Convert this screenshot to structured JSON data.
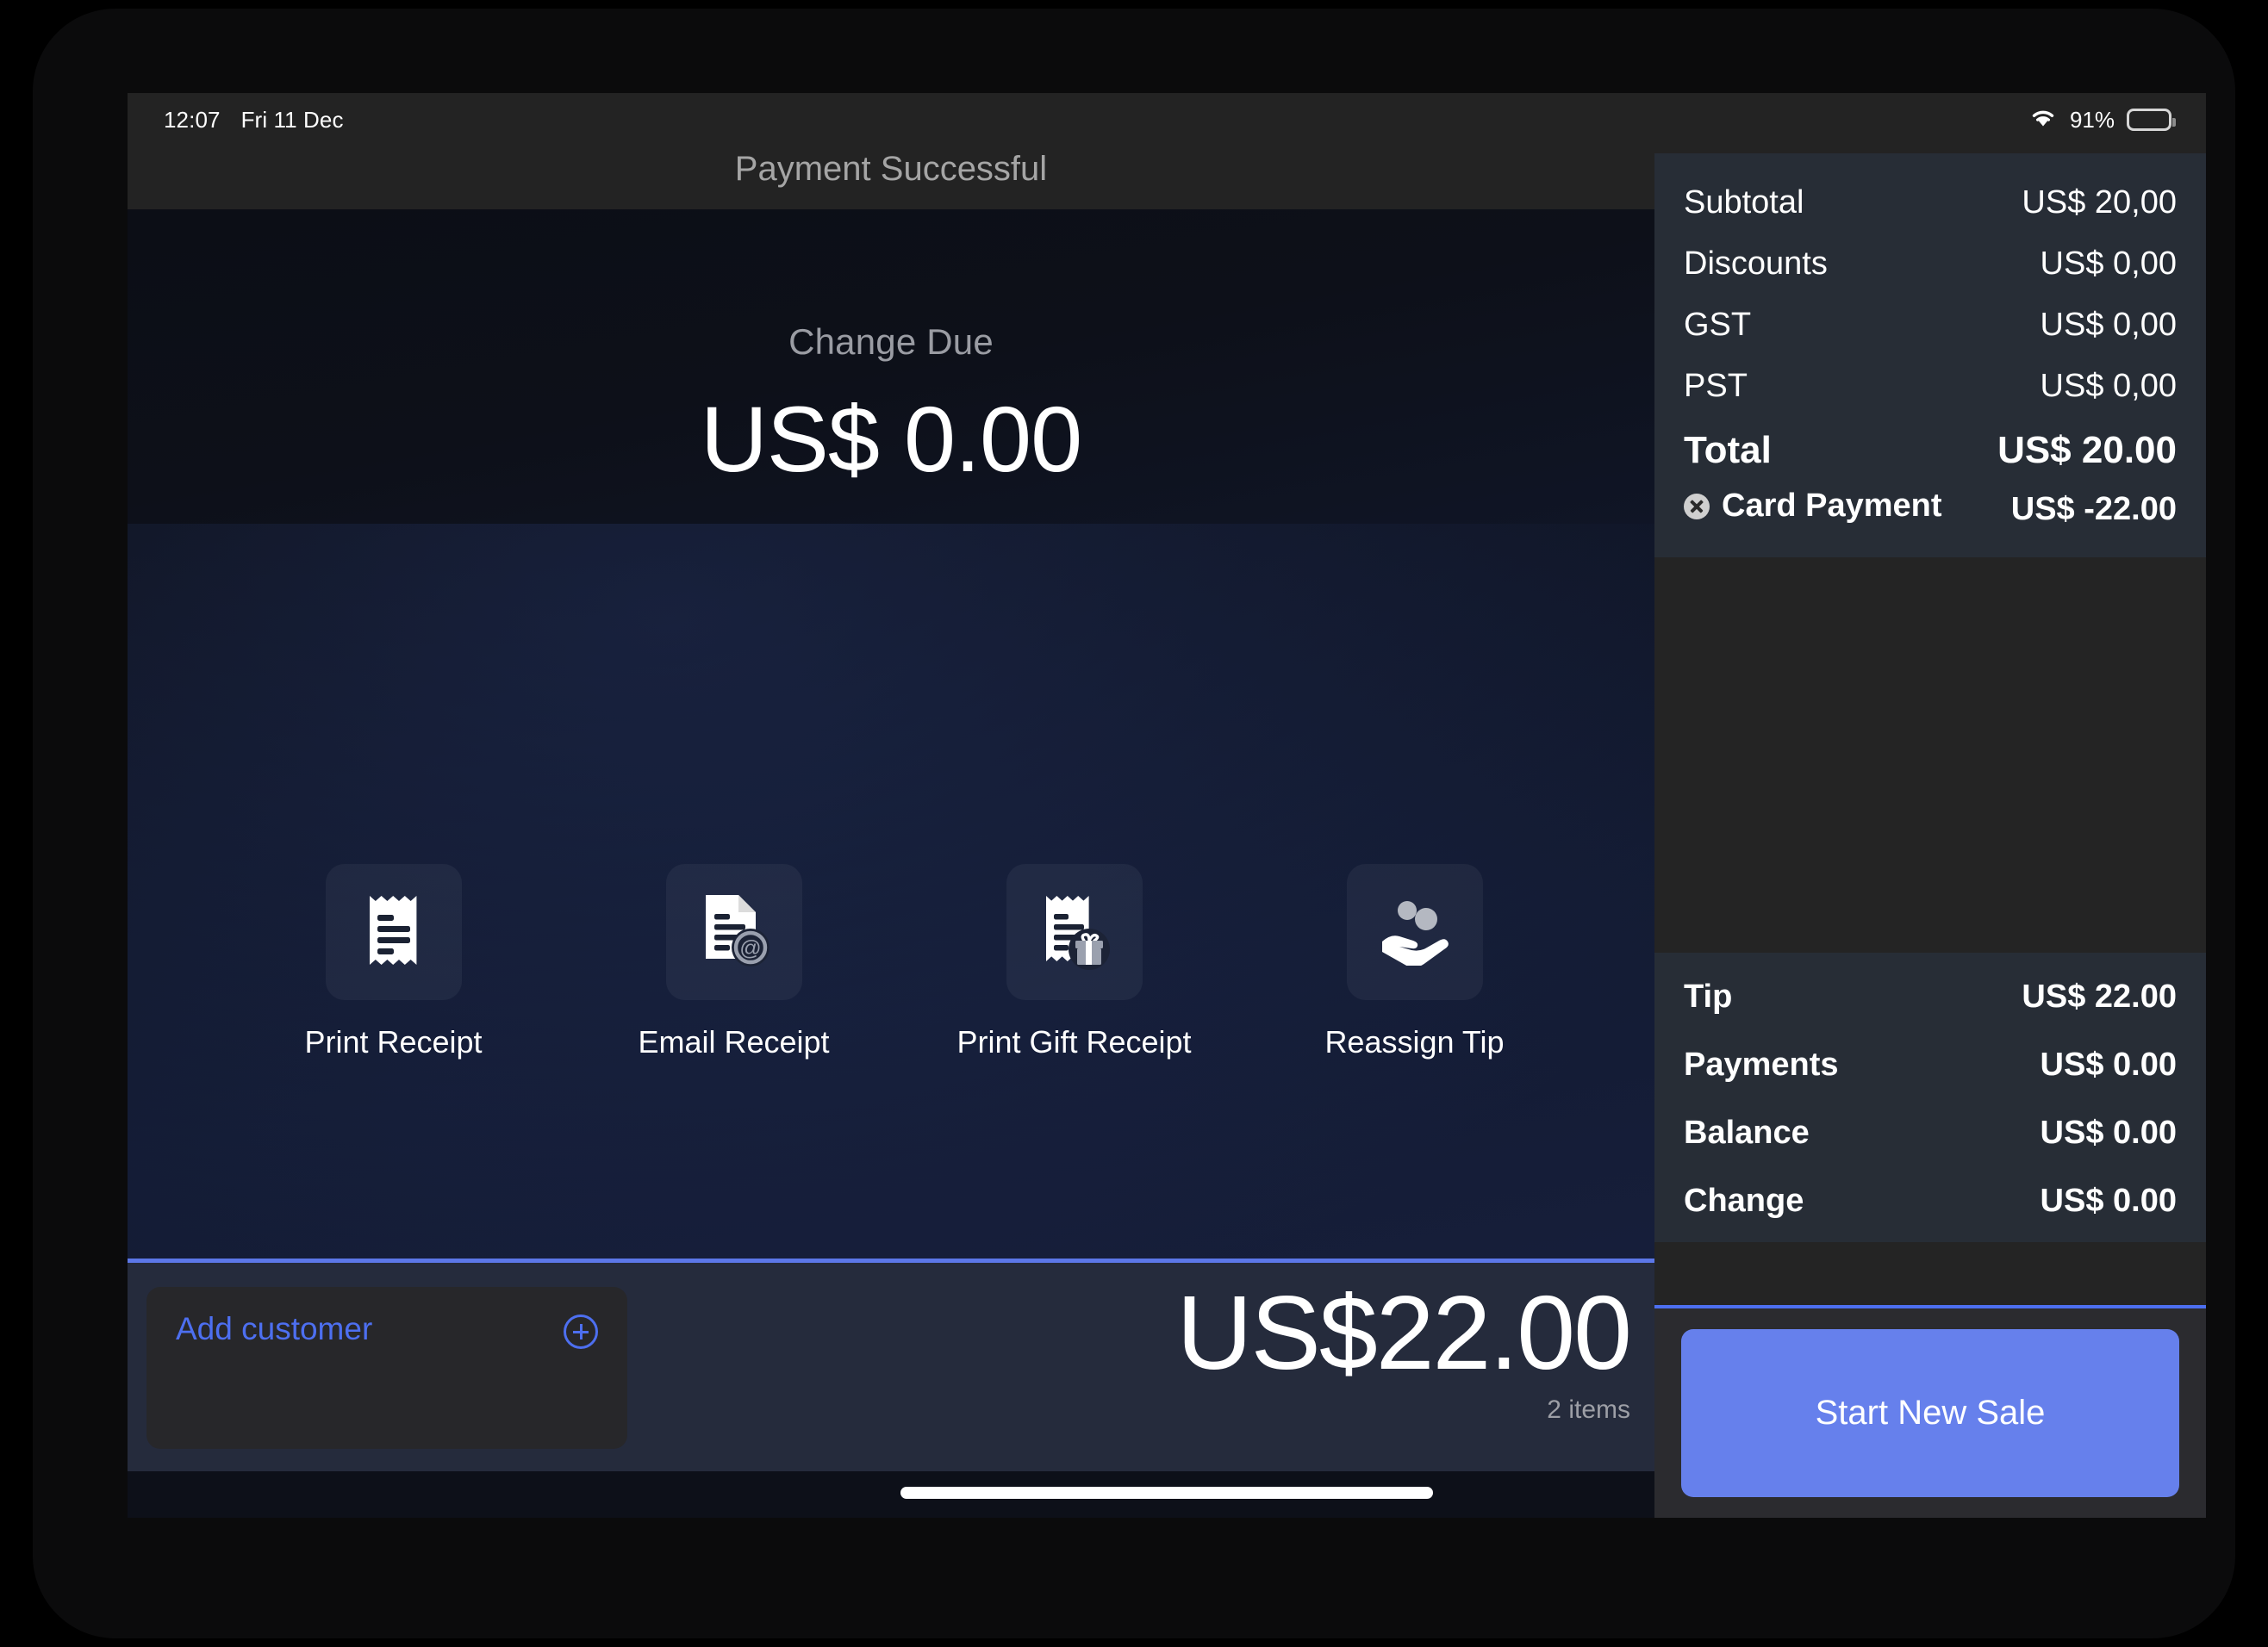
{
  "status_bar": {
    "time": "12:07",
    "date": "Fri 11 Dec",
    "wifi_icon": "wifi-icon",
    "battery_percent": "91%",
    "battery_icon": "battery-full-icon"
  },
  "header": {
    "title": "Payment Successful"
  },
  "main": {
    "change_due_label": "Change Due",
    "change_due_amount": "US$ 0.00",
    "actions": [
      {
        "label": "Print Receipt",
        "icon": "receipt-icon"
      },
      {
        "label": "Email Receipt",
        "icon": "receipt-email-icon"
      },
      {
        "label": "Print Gift Receipt",
        "icon": "receipt-gift-icon"
      },
      {
        "label": "Reassign Tip",
        "icon": "hand-coins-icon"
      }
    ]
  },
  "bottom_bar": {
    "add_customer_label": "Add customer",
    "add_customer_icon": "plus-circle-icon",
    "grand_total": "US$22.00",
    "item_count": "2 items"
  },
  "receipt": {
    "totals": [
      {
        "label": "Subtotal",
        "value": "US$ 20,00"
      },
      {
        "label": "Discounts",
        "value": "US$ 0,00"
      },
      {
        "label": "GST",
        "value": "US$ 0,00"
      },
      {
        "label": "PST",
        "value": "US$ 0,00"
      }
    ],
    "grand": {
      "label": "Total",
      "value": "US$ 20.00"
    },
    "payment": {
      "label": "Card Payment",
      "value": "US$ -22.00",
      "remove_icon": "remove-circle-icon"
    },
    "summary": [
      {
        "label": "Tip",
        "value": "US$ 22.00"
      },
      {
        "label": "Payments",
        "value": "US$ 0.00"
      },
      {
        "label": "Balance",
        "value": "US$ 0.00"
      },
      {
        "label": "Change",
        "value": "US$ 0.00"
      }
    ],
    "start_new_sale_label": "Start New Sale"
  },
  "colors": {
    "accent_blue": "#6680ec",
    "link_blue": "#4d6ff0",
    "panel_slate": "#272d36",
    "main_navy": "#131b33"
  }
}
